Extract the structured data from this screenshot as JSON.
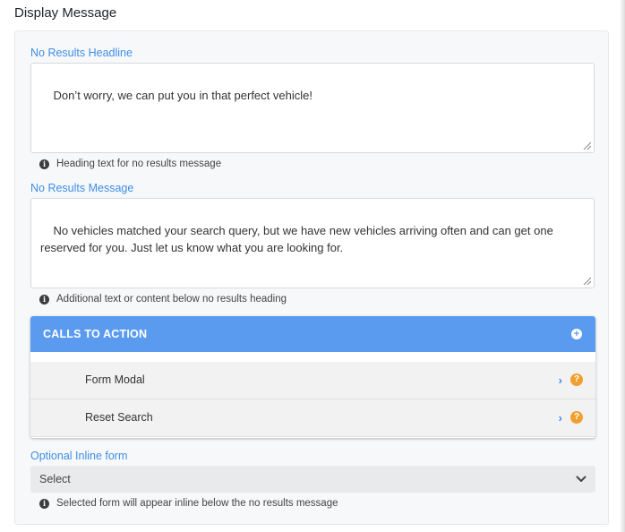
{
  "page": {
    "title": "Display Message"
  },
  "headline": {
    "label": "No Results Headline",
    "value": "Don’t worry, we can put you in that perfect vehicle!",
    "help": "Heading text for no results message"
  },
  "message": {
    "label": "No Results Message",
    "value": "No vehicles matched your search query, but we have new vehicles arriving often and can get one reserved for you. Just let us know what you are looking for.",
    "help": "Additional text or content below no results heading"
  },
  "cta": {
    "title": "CALLS TO ACTION",
    "items": [
      {
        "label": "Form Modal"
      },
      {
        "label": "Reset Search"
      }
    ]
  },
  "inline_form": {
    "label": "Optional Inline form",
    "selected": "Select",
    "help": "Selected form will appear inline below the no results message"
  },
  "colors": {
    "accent": "#3e8ee6",
    "cta_header": "#5b9bef",
    "help_badge": "#f0a030"
  },
  "icons": {
    "info": "info-circle-icon",
    "add": "plus-circle-icon",
    "chevron": "chevron-right-icon",
    "help": "question-circle-icon",
    "dropdown": "chevron-down-icon"
  }
}
